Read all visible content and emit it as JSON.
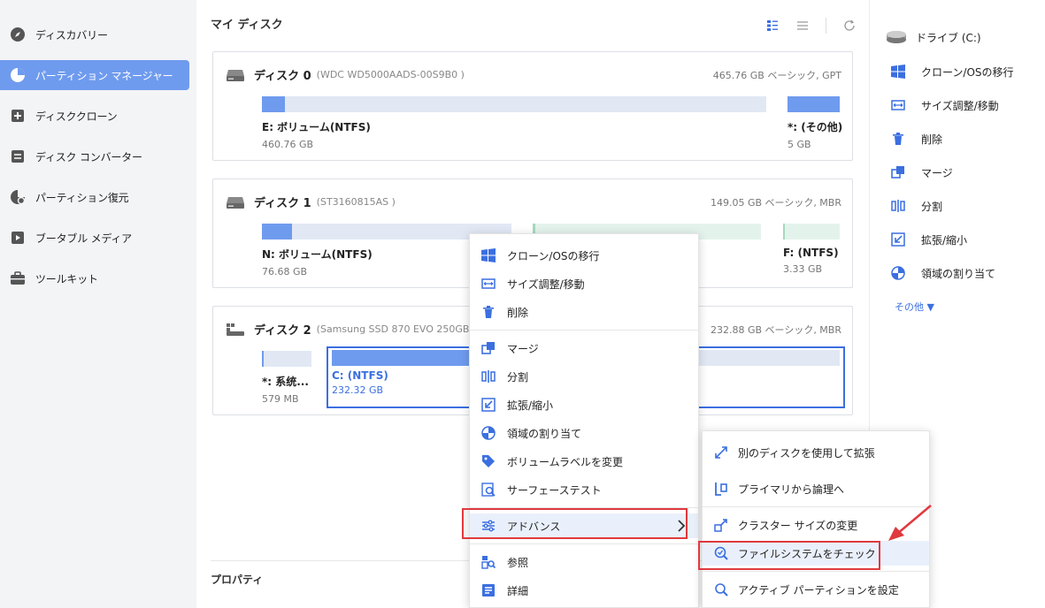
{
  "sidebar": {
    "items": [
      {
        "label": "ディスカバリー",
        "icon": "compass-icon",
        "active": false
      },
      {
        "label": "パーティション マネージャー",
        "icon": "pie-chart-icon",
        "active": true
      },
      {
        "label": "ディスククローン",
        "icon": "disk-clone-icon",
        "active": false
      },
      {
        "label": "ディスク コンバーター",
        "icon": "disk-converter-icon",
        "active": false
      },
      {
        "label": "パーティション復元",
        "icon": "partition-recovery-icon",
        "active": false
      },
      {
        "label": "ブータブル メディア",
        "icon": "bootable-media-icon",
        "active": false
      },
      {
        "label": "ツールキット",
        "icon": "toolkit-icon",
        "active": false
      }
    ]
  },
  "main": {
    "title": "マイ ディスク",
    "properties_label": "プロパティ",
    "disks": [
      {
        "name": "ディスク 0",
        "model": "(WDC WD5000AADS-00S9B0 )",
        "info": "465.76 GB ベーシック, GPT",
        "partitions": [
          {
            "name": "E: ボリューム(NTFS)",
            "size": "460.76 GB",
            "used_fraction": 0.045
          },
          {
            "name": "*: (その他)",
            "size": "5 GB",
            "used_fraction": 1.0
          }
        ]
      },
      {
        "name": "ディスク 1",
        "model": "(ST3160815AS )",
        "info": "149.05 GB ベーシック, MBR",
        "partitions": [
          {
            "name": "N: ボリューム(NTFS)",
            "size": "76.68 GB",
            "used_fraction": 0.12
          },
          {
            "name": "",
            "size": "",
            "used_fraction": 0.01
          },
          {
            "name": "F: (NTFS)",
            "size": "3.33 GB",
            "used_fraction": 0.03
          }
        ]
      },
      {
        "name": "ディスク 2",
        "model": "(Samsung SSD 870 EVO 250GB )",
        "info": "232.88 GB ベーシック, MBR",
        "partitions": [
          {
            "name": "*: 系统...",
            "size": "579 MB",
            "used_fraction": 0.04
          },
          {
            "name": "C: (NTFS)",
            "size": "232.32 GB",
            "used_fraction": 0.42,
            "selected": true
          }
        ]
      }
    ]
  },
  "right_panel": {
    "drive_label": "ドライブ (C:)",
    "actions": [
      {
        "label": "クローン/OSの移行",
        "icon": "windows-icon"
      },
      {
        "label": "サイズ調整/移動",
        "icon": "resize-icon"
      },
      {
        "label": "削除",
        "icon": "trash-icon"
      },
      {
        "label": "マージ",
        "icon": "merge-icon"
      },
      {
        "label": "分割",
        "icon": "split-icon"
      },
      {
        "label": "拡張/縮小",
        "icon": "extend-shrink-icon"
      },
      {
        "label": "領域の割り当て",
        "icon": "allocate-space-icon"
      }
    ],
    "more_label": "その他 ▼"
  },
  "context_menu": {
    "items": [
      {
        "label": "クローン/OSの移行",
        "icon": "windows-icon"
      },
      {
        "label": "サイズ調整/移動",
        "icon": "resize-icon"
      },
      {
        "label": "削除",
        "icon": "trash-icon"
      },
      {
        "label": "マージ",
        "icon": "merge-icon"
      },
      {
        "label": "分割",
        "icon": "split-icon"
      },
      {
        "label": "拡張/縮小",
        "icon": "extend-shrink-icon"
      },
      {
        "label": "領域の割り当て",
        "icon": "allocate-space-icon"
      },
      {
        "label": "ボリュームラベルを変更",
        "icon": "tag-icon"
      },
      {
        "label": "サーフェーステスト",
        "icon": "surface-test-icon"
      },
      {
        "label": "アドバンス",
        "icon": "sliders-icon"
      },
      {
        "label": "参照",
        "icon": "explore-icon"
      },
      {
        "label": "詳細",
        "icon": "details-icon"
      }
    ]
  },
  "submenu": {
    "items": [
      {
        "label": "別のディスクを使用して拡張",
        "icon": "expand-arrows-icon"
      },
      {
        "label": "プライマリから論理へ",
        "icon": "primary-to-logical-icon"
      },
      {
        "label": "クラスター サイズの変更",
        "icon": "cluster-size-icon"
      },
      {
        "label": "ファイルシステムをチェック",
        "icon": "check-filesystem-icon"
      },
      {
        "label": "アクティブ パーティションを設定",
        "icon": "set-active-icon"
      }
    ]
  },
  "colors": {
    "accent": "#6f9bee",
    "selected_border": "#3b6fe0",
    "highlight_box": "#e0393e",
    "partition_bg": "#e1e8f4"
  }
}
